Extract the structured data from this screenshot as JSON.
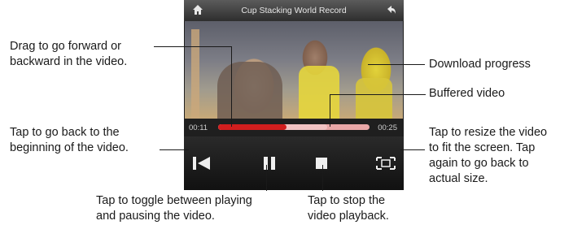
{
  "player": {
    "title": "Cup Stacking World Record",
    "time_elapsed": "00:11",
    "time_total": "00:25",
    "played_fraction": 0.45,
    "buffered_fraction": 0.72,
    "icons": [
      "home-icon",
      "back-arrow-icon",
      "skip-to-start-icon",
      "pause-icon",
      "stop-icon",
      "resize-icon"
    ]
  },
  "callouts": {
    "drag_line1": "Drag to go forward or",
    "drag_line2": "backward in the video.",
    "download": "Download progress",
    "buffered": "Buffered video",
    "back_line1": "Tap to go back to the",
    "back_line2": "beginning of the video.",
    "resize_line1": "Tap to resize the video",
    "resize_line2": "to fit the screen. Tap",
    "resize_line3": "again to go back to",
    "resize_line4": "actual size.",
    "toggle_line1": "Tap to toggle between playing",
    "toggle_line2": "and pausing the video.",
    "stop_line1": "Tap to stop the",
    "stop_line2": "video playback."
  },
  "colors": {
    "progress_fill": "#d11e1e",
    "progress_track": "#e9a7a7",
    "controls_bg": "#111111"
  }
}
